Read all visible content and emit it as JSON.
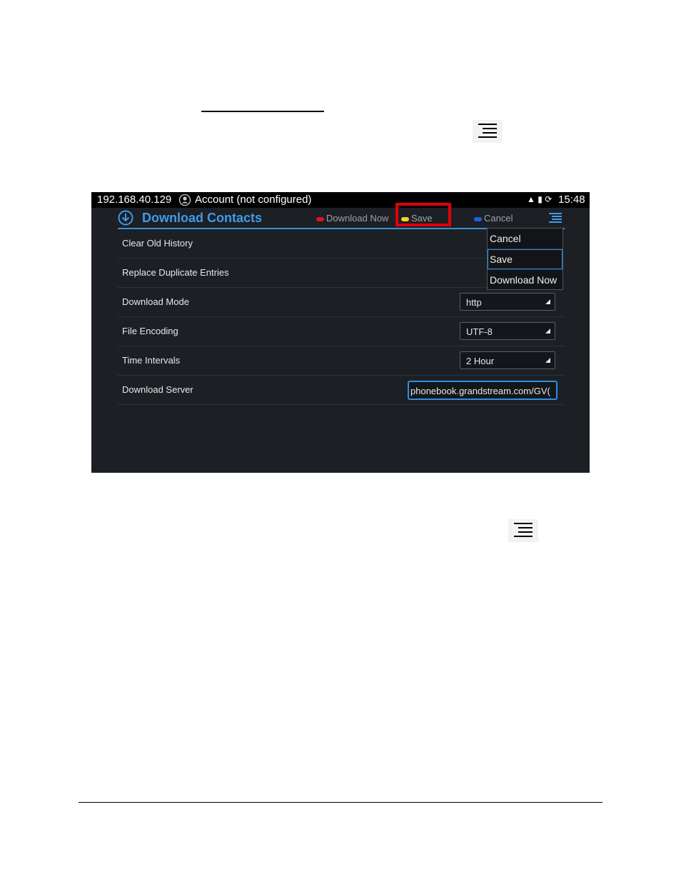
{
  "status_bar": {
    "ip": "192.168.40.129",
    "account": "Account (not configured)",
    "time": "15:48"
  },
  "header": {
    "title": "Download Contacts",
    "softkeys": {
      "download_now": "Download Now",
      "save": "Save",
      "cancel": "Cancel"
    },
    "softkey_colors": {
      "download_now": "#e0151b",
      "save": "#f4d51b",
      "cancel": "#1e5fe6"
    }
  },
  "settings": {
    "clear_old_history": "Clear Old History",
    "replace_duplicate_entries": "Replace Duplicate Entries",
    "download_mode": {
      "label": "Download Mode",
      "value": "http"
    },
    "file_encoding": {
      "label": "File Encoding",
      "value": "UTF-8"
    },
    "time_intervals": {
      "label": "Time Intervals",
      "value": "2 Hour"
    },
    "download_server": {
      "label": "Download Server",
      "value": "phonebook.grandstream.com/GV("
    }
  },
  "menu": {
    "items": [
      "Cancel",
      "Save",
      "Download Now"
    ],
    "selected": "Save"
  },
  "colors": {
    "accent": "#3d9be9",
    "highlight": "#e0000a",
    "background": "#1c1f24"
  }
}
